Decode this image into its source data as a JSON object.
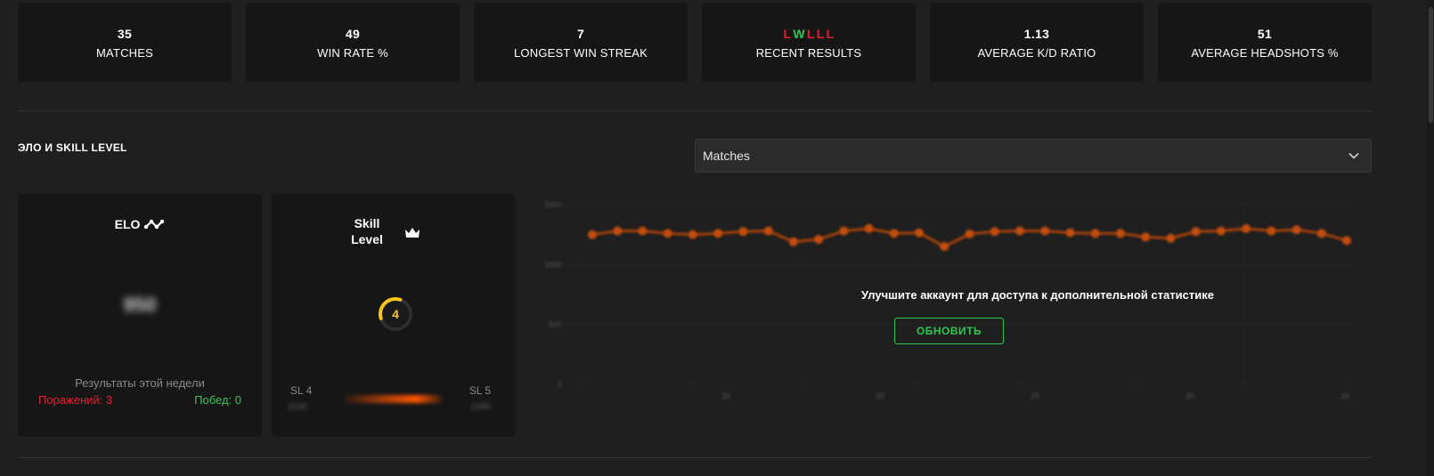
{
  "stats": [
    {
      "value": "35",
      "label": "MATCHES"
    },
    {
      "value": "49",
      "label": "WIN RATE %"
    },
    {
      "value": "7",
      "label": "LONGEST WIN STREAK"
    },
    {
      "value": "",
      "label": "RECENT RESULTS"
    },
    {
      "value": "1.13",
      "label": "AVERAGE K/D RATIO"
    },
    {
      "value": "51",
      "label": "AVERAGE HEADSHOTS %"
    }
  ],
  "recent_results": [
    "L",
    "W",
    "L",
    "L",
    "L"
  ],
  "colors": {
    "loss": "#e5202e",
    "win": "#32c552",
    "accent": "#ff5500",
    "skill": "#f5c518"
  },
  "section": {
    "title": "ЭЛО И SKILL LEVEL"
  },
  "dropdown": {
    "selected": "Matches"
  },
  "elo": {
    "title": "ELO",
    "value": "950",
    "week_title": "Результаты этой недели",
    "losses": "Поражений: 3",
    "wins": "Побед: 0"
  },
  "skill": {
    "title": "Skill Level",
    "level": "4",
    "level_fraction": 0.4,
    "left_label": "SL 4",
    "right_label": "SL 5",
    "left_value": "1100",
    "right_value": "1250"
  },
  "upgrade": {
    "message": "Улучшите аккаунт для доступа к дополнительной статистике",
    "button": "ОБНОВИТЬ"
  },
  "chart_data": {
    "type": "line",
    "values": [
      1250,
      1280,
      1280,
      1260,
      1250,
      1260,
      1275,
      1280,
      1190,
      1210,
      1280,
      1300,
      1260,
      1265,
      1150,
      1255,
      1275,
      1280,
      1280,
      1265,
      1260,
      1260,
      1230,
      1220,
      1275,
      1280,
      1300,
      1280,
      1290,
      1260,
      1200
    ],
    "ylim": [
      0,
      1500
    ],
    "yticks": [
      "1500",
      "1000",
      "500",
      "0"
    ],
    "xticks": [
      "35",
      "30",
      "25",
      "20",
      "15",
      "10"
    ]
  }
}
